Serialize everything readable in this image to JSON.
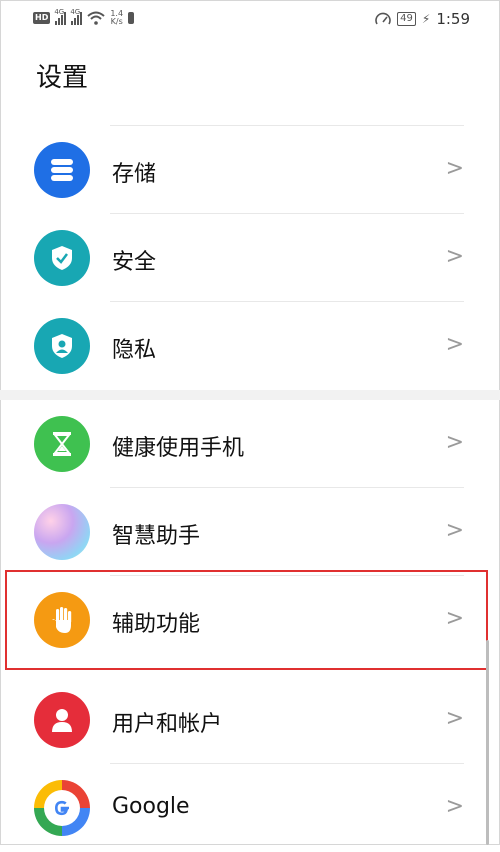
{
  "status_bar": {
    "hd": "HD",
    "signal1": "4G",
    "signal2": "4G",
    "speed_value": "1.4",
    "speed_unit": "K/s",
    "battery": "49",
    "time": "1:59"
  },
  "page_title": "设置",
  "items": [
    {
      "label": "存储",
      "icon": "storage-icon",
      "color": "#1f6fe5"
    },
    {
      "label": "安全",
      "icon": "security-shield-icon",
      "color": "#18a7b3"
    },
    {
      "label": "隐私",
      "icon": "privacy-icon",
      "color": "#18a7b3"
    },
    {
      "label": "健康使用手机",
      "icon": "hourglass-icon",
      "color": "#3fc150"
    },
    {
      "label": "智慧助手",
      "icon": "smart-assistant-icon",
      "color": "#c9a6f0"
    },
    {
      "label": "辅助功能",
      "icon": "hand-icon",
      "color": "#f59a12"
    },
    {
      "label": "用户和帐户",
      "icon": "user-icon",
      "color": "#e52d3a"
    },
    {
      "label": "Google",
      "icon": "google-icon",
      "color": "#ffffff"
    }
  ],
  "chevron": ">"
}
